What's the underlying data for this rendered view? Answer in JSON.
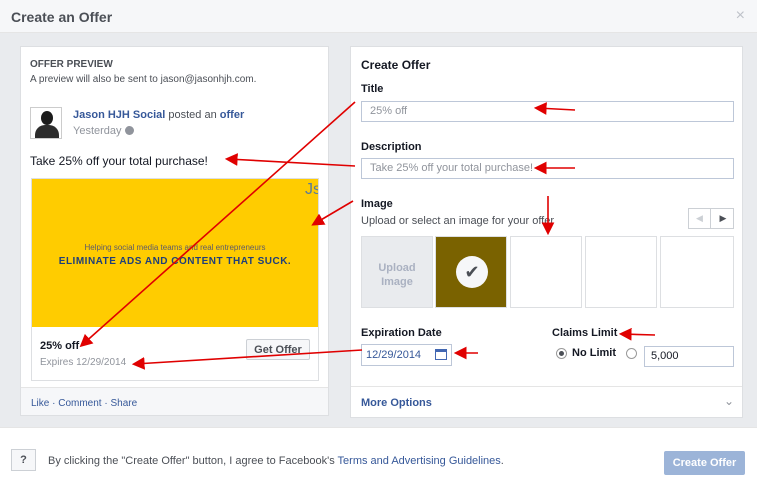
{
  "dialog": {
    "title": "Create an Offer",
    "close": "×"
  },
  "preview": {
    "heading": "OFFER PREVIEW",
    "note": "A preview will also be sent to jason@jasonhjh.com.",
    "page_name": "Jason HJH Social",
    "verb": "posted an",
    "offer_word": "offer",
    "time": "Yesterday",
    "message": "Take 25% off your total purchase!",
    "banner": {
      "brand_partial": "Js",
      "tagline": "Helping social media teams and real entrepreneurs",
      "headline": "ELIMINATE ADS AND CONTENT THAT SUCK."
    },
    "offer_title": "25% off",
    "expires": "Expires 12/29/2014",
    "get_offer": "Get Offer",
    "footer_links": "Like · Comment · Share"
  },
  "form": {
    "heading": "Create Offer",
    "title_label": "Title",
    "title_value": "25% off",
    "description_label": "Description",
    "description_value": "Take 25% off your total purchase!",
    "image_label": "Image",
    "image_sub": "Upload or select an image for your offer",
    "upload_line1": "Upload",
    "upload_line2": "Image",
    "expiration_label": "Expiration Date",
    "expiration_value": "12/29/2014",
    "claims_label": "Claims Limit",
    "no_limit": "No Limit",
    "limit_value": "5,000",
    "more_options": "More Options"
  },
  "footer": {
    "help": "?",
    "agree_text": "By clicking the \"Create Offer\" button, I agree to Facebook's",
    "agree_link": "Terms and Advertising Guidelines",
    "agree_end": ".",
    "create_button": "Create Offer"
  },
  "icons": [
    "close-icon",
    "globe-icon",
    "checkmark-icon",
    "calendar-icon",
    "chevron-down-icon",
    "arrow-left-icon",
    "arrow-right-icon",
    "help-icon"
  ],
  "colors": {
    "brand": "#365899",
    "annotation_arrow": "#e00000",
    "banner": "#ffcc00",
    "create_button": "#9cb4d8"
  }
}
